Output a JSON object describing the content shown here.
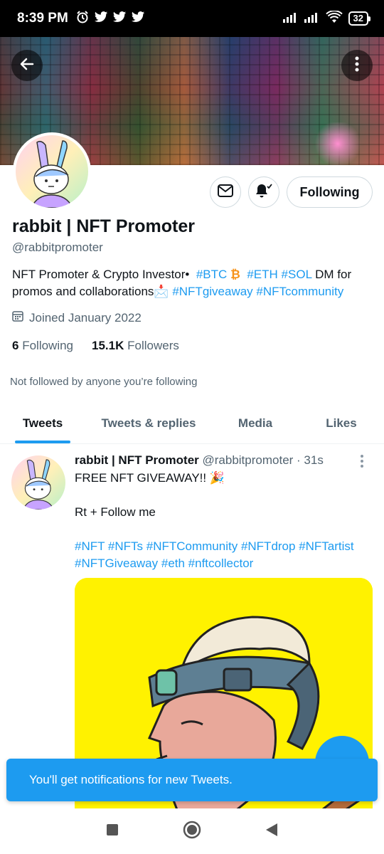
{
  "status_bar": {
    "time": "8:39 PM",
    "battery": "32"
  },
  "profile": {
    "name": "rabbit | NFT Promoter",
    "handle": "@rabbitpromoter",
    "bio": {
      "part1": "NFT Promoter & Crypto Investor•",
      "tag_btc": "#BTC",
      "btc_symbol": "₿",
      "tag_eth": "#ETH",
      "tag_sol": "#SOL",
      "part2": "DM for promos and collaborations",
      "inbox_emoji": "📩",
      "tag_giveaway": "#NFTgiveaway",
      "tag_community": "#NFTcommunity"
    },
    "joined": "Joined January 2022",
    "following_count": "6",
    "following_label": "Following",
    "followers_count": "15.1K",
    "followers_label": "Followers",
    "not_followed": "Not followed by anyone you’re following",
    "follow_button_label": "Following"
  },
  "tabs": [
    {
      "label": "Tweets",
      "active": true
    },
    {
      "label": "Tweets & replies",
      "active": false
    },
    {
      "label": "Media",
      "active": false
    },
    {
      "label": "Likes",
      "active": false
    }
  ],
  "tweet": {
    "author_name": "rabbit | NFT Promoter",
    "author_handle": "@rabbitpromoter",
    "time": "· 31s",
    "line1": "FREE NFT GIVEAWAY!!",
    "party_emoji": "🎉",
    "line2": "Rt + Follow me",
    "hashtags_line1": "#NFT #NFTs #NFTCommunity #NFTdrop #NFTartist",
    "hashtags_line2": "#NFTGiveaway #eth #nftcollector"
  },
  "toast": {
    "message": "You'll get notifications for new Tweets."
  },
  "colors": {
    "accent": "#1d9bf0",
    "text": "#0f1419",
    "muted": "#536471",
    "media_bg": "#fff200"
  },
  "icons": [
    "alarm-icon",
    "twitter-bird-icon",
    "signal-icon",
    "wifi-icon",
    "battery-icon",
    "back-arrow-icon",
    "more-vertical-icon",
    "mail-icon",
    "bell-icon",
    "calendar-icon",
    "more-vertical-icon",
    "compose-icon",
    "nav-square-icon",
    "nav-home-icon",
    "nav-back-icon"
  ]
}
